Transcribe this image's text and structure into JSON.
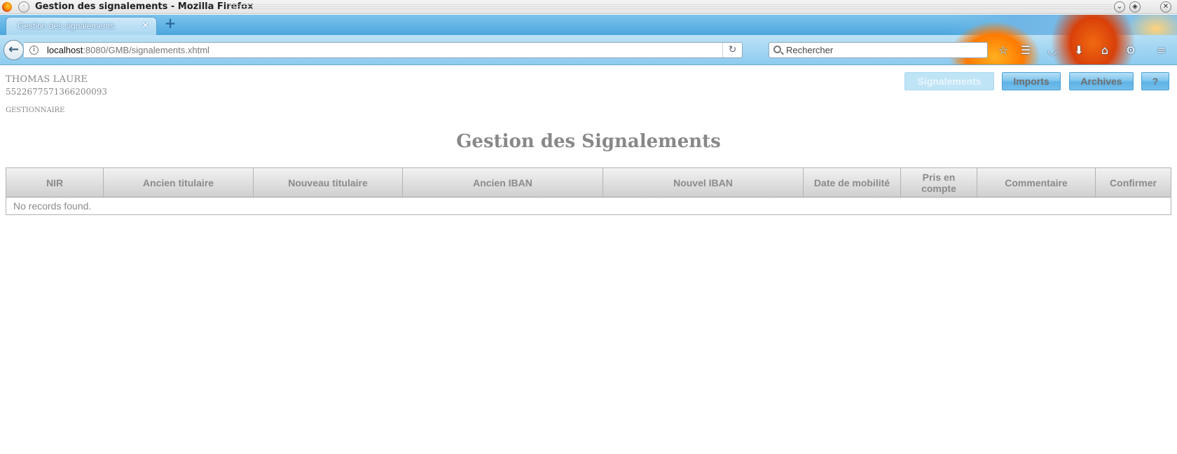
{
  "window": {
    "title": "Gestion des signalements - Mozilla Firefox",
    "menu_icon": "window-menu-icon",
    "controls": [
      "minimize-icon",
      "maximize-icon",
      "close-icon"
    ]
  },
  "tabs": [
    {
      "label": "Gestion des signalements",
      "close": "×",
      "active": true
    }
  ],
  "newtab_label": "+",
  "navbar": {
    "back_label": "←",
    "url_host": "localhost",
    "url_rest": ":8080/GMB/signalements.xhtml",
    "reload_label": "↻",
    "search_placeholder": "Rechercher",
    "toolbar_icons": [
      "bookmark-star-icon",
      "reading-list-icon",
      "pocket-icon",
      "download-icon",
      "home-icon",
      "sync-icon",
      "hamburger-menu-icon"
    ]
  },
  "user": {
    "name": "THOMAS LAURE",
    "nir": "5522677571366200093",
    "role": "GESTIONNAIRE"
  },
  "nav_buttons": [
    {
      "label": "Signalements",
      "disabled": true
    },
    {
      "label": "Imports",
      "disabled": false
    },
    {
      "label": "Archives",
      "disabled": false
    },
    {
      "label": "?",
      "disabled": false
    }
  ],
  "page_title": "Gestion des Signalements",
  "table": {
    "columns": [
      "NIR",
      "Ancien titulaire",
      "Nouveau titulaire",
      "Ancien IBAN",
      "Nouvel IBAN",
      "Date de mobilité",
      "Pris en compte",
      "Commentaire",
      "Confirmer"
    ],
    "empty_message": "No records found."
  },
  "colors": {
    "accent": "#5eb3e6",
    "muted_text": "#888888"
  }
}
